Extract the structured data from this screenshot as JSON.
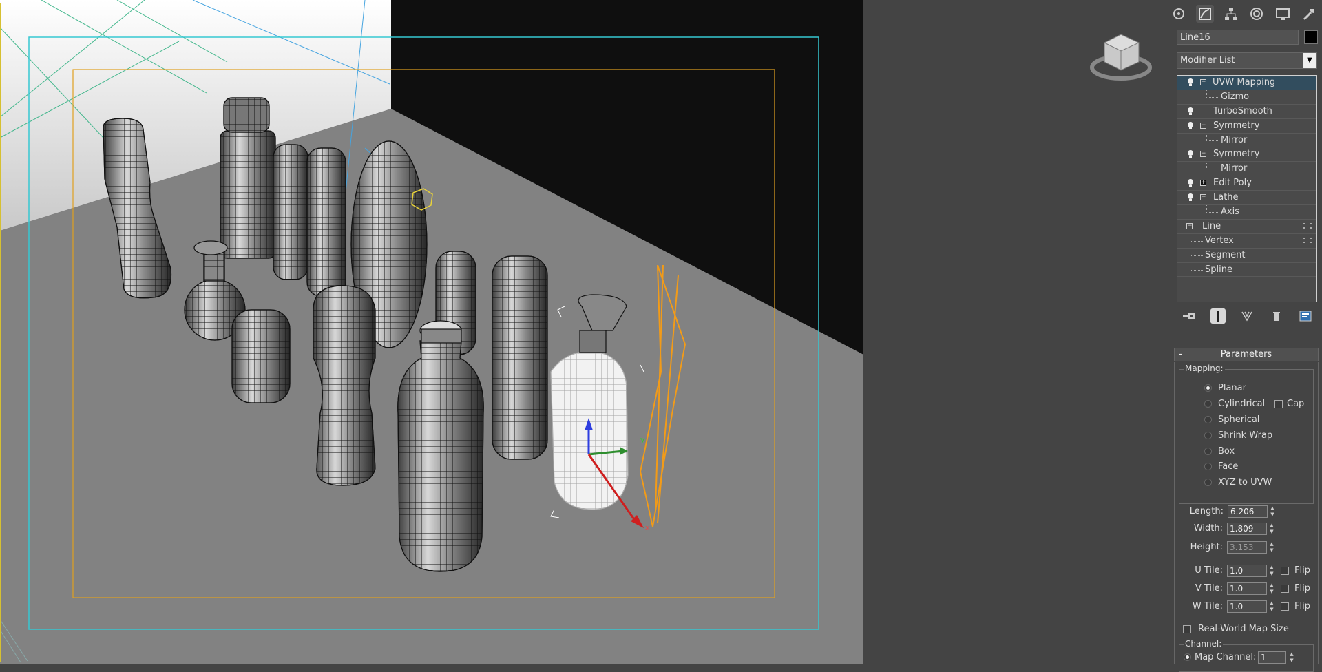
{
  "object_name": "Line16",
  "modifier_list": {
    "label": "Modifier List"
  },
  "stack": [
    {
      "label": "UVW Mapping",
      "selected": true,
      "sub": [
        "Gizmo"
      ]
    },
    {
      "label": "TurboSmooth",
      "sub": []
    },
    {
      "label": "Symmetry",
      "sub": [
        "Mirror"
      ]
    },
    {
      "label": "Symmetry",
      "sub": [
        "Mirror"
      ]
    },
    {
      "label": "Edit Poly",
      "sub": []
    },
    {
      "label": "Lathe",
      "sub": [
        "Axis"
      ]
    },
    {
      "label": "Line",
      "sub": [
        "Vertex",
        "Segment",
        "Spline"
      ]
    }
  ],
  "stack_labels": {
    "uvw": "UVW Mapping",
    "gizmo": "Gizmo",
    "turbosmooth": "TurboSmooth",
    "symmetry1": "Symmetry",
    "mirror1": "Mirror",
    "symmetry2": "Symmetry",
    "mirror2": "Mirror",
    "editpoly": "Edit Poly",
    "lathe": "Lathe",
    "axis": "Axis",
    "line": "Line",
    "vertex": "Vertex",
    "segment": "Segment",
    "spline": "Spline"
  },
  "parameters": {
    "title": "Parameters",
    "collapse": "-",
    "mapping_label": "Mapping:",
    "mapping_options": {
      "planar": "Planar",
      "cylindrical": "Cylindrical",
      "cap": "Cap",
      "spherical": "Spherical",
      "shrink": "Shrink Wrap",
      "box": "Box",
      "face": "Face",
      "xyz": "XYZ to UVW"
    },
    "selected_mapping": "Planar",
    "length_label": "Length:",
    "length": "6.206",
    "width_label": "Width:",
    "width": "1.809",
    "height_label": "Height:",
    "height": "3.153",
    "utile_label": "U Tile:",
    "utile": "1.0",
    "vtile_label": "V Tile:",
    "vtile": "1.0",
    "wtile_label": "W Tile:",
    "wtile": "1.0",
    "flip_label": "Flip",
    "realworld_label": "Real-World Map Size",
    "channel_label": "Channel:",
    "map_channel_label": "Map Channel:",
    "map_channel": "1"
  },
  "colors": {
    "selection_yellow": "#d6c031",
    "safe_frame_cyan": "#36c8d2",
    "safe_frame_orange": "#e0a020",
    "gizmo_orange": "#f29b18"
  },
  "icons": {
    "tabs": [
      "create-icon",
      "modify-icon",
      "hierarchy-icon",
      "motion-icon",
      "display-icon",
      "utilities-icon"
    ],
    "stack_tools": [
      "pin-stack-icon",
      "show-end-result-icon",
      "make-unique-icon",
      "remove-modifier-icon",
      "configure-modifier-sets-icon"
    ]
  }
}
